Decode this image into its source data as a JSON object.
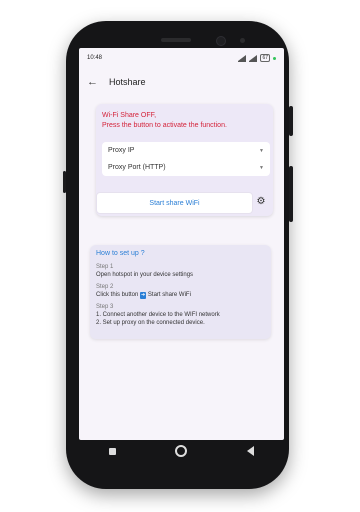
{
  "status_bar": {
    "time": "10:48",
    "battery": "67"
  },
  "app": {
    "title": "Hotshare",
    "back_icon": "arrow-left-icon"
  },
  "share_card": {
    "status_line1": "Wi-Fi Share OFF,",
    "status_line2": "Press the button to activate the function.",
    "proxy_ip_label": "Proxy IP",
    "proxy_port_label": "Proxy Port (HTTP)",
    "button_label": "Start share WiFi",
    "settings_icon": "gear-icon"
  },
  "howto": {
    "title": "How to set up ?",
    "steps": [
      {
        "label": "Step 1",
        "text": "Open hotspot in your device settings"
      },
      {
        "label": "Step 2",
        "text_before": "Click this button",
        "text_after": "Start share WiFi"
      },
      {
        "label": "Step 3",
        "line1": "1. Connect another device to the WIFI network",
        "line2": "2. Set up proxy on the connected device."
      }
    ]
  },
  "colors": {
    "accent": "#2b7fd6",
    "warning": "#d4233a"
  }
}
